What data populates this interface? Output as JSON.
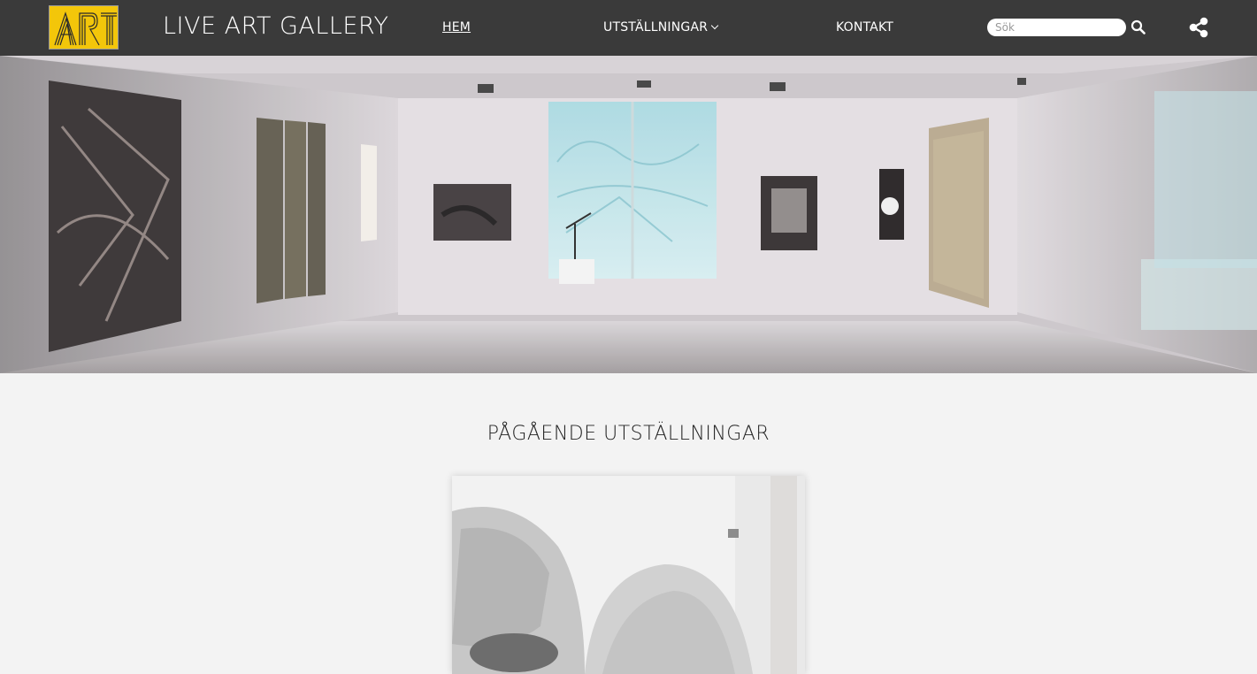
{
  "header": {
    "logo_text": "ART",
    "site_title": "LIVE ART GALLERY",
    "brand_color": "#f3c60a",
    "nav": {
      "home": "HEM",
      "exhibitions": "UTSTÄLLNINGAR",
      "contact": "KONTAKT"
    },
    "search": {
      "placeholder": "Sök",
      "value": ""
    },
    "icons": {
      "search": "search-icon",
      "share": "share-icon",
      "dropdown": "chevron-down-icon"
    }
  },
  "hero": {
    "image": "gallery-interior-photo"
  },
  "main": {
    "section_title": "PÅGÅENDE UTSTÄLLNINGAR",
    "cards": [
      {
        "image": "sculpture-photo"
      }
    ]
  }
}
